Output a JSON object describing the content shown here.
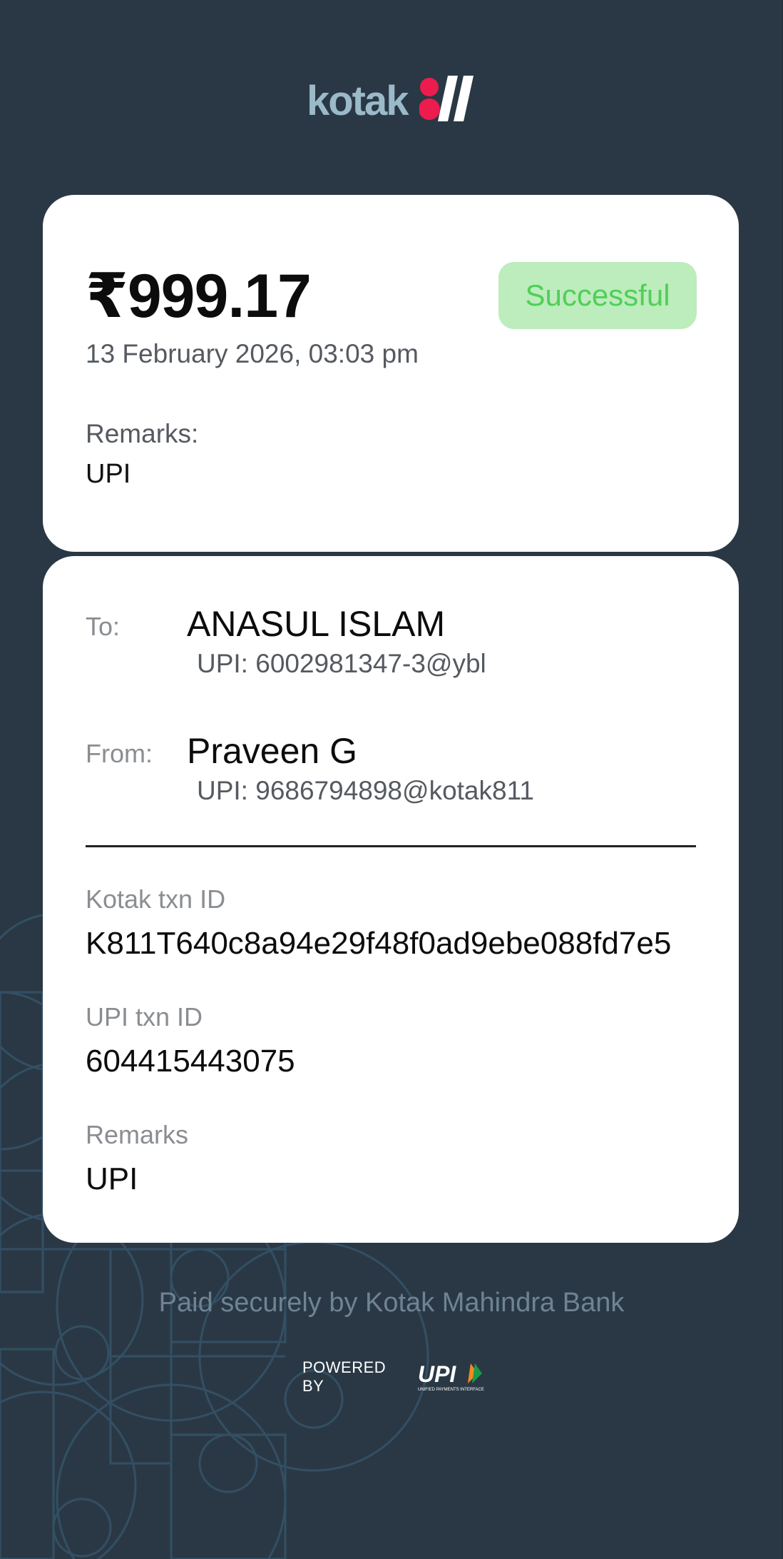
{
  "brand": {
    "logo_text": "kotak",
    "accent": "#ed1c4f",
    "logo_text_color": "#9bb9c9"
  },
  "summary": {
    "amount": "₹999.17",
    "status": "Successful",
    "datetime": "13 February 2026, 03:03 pm",
    "remarks_label": "Remarks:",
    "remarks_value": "UPI"
  },
  "details": {
    "to": {
      "label": "To:",
      "name": "ANASUL ISLAM",
      "upi": "UPI: 6002981347-3@ybl"
    },
    "from": {
      "label": "From:",
      "name": "Praveen G",
      "upi": "UPI: 9686794898@kotak811"
    },
    "kotak_txn": {
      "label": "Kotak txn ID",
      "value": "K811T640c8a94e29f48f0ad9ebe088fd7e5"
    },
    "upi_txn": {
      "label": "UPI txn ID",
      "value": "604415443075"
    },
    "remarks": {
      "label": "Remarks",
      "value": "UPI"
    }
  },
  "footer": {
    "paid_text": "Paid securely by Kotak Mahindra Bank",
    "powered_by": "POWERED BY",
    "upi_logo_text": "UPI",
    "upi_logo_subtext": "UNIFIED PAYMENTS INTERFACE"
  },
  "colors": {
    "background": "#2a3845",
    "status_bg": "#bdecbd",
    "status_text": "#4fcf57"
  }
}
